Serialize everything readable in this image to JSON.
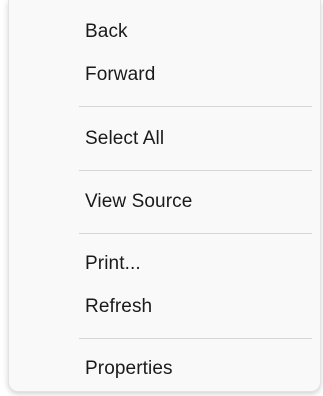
{
  "context_menu": {
    "items": [
      {
        "label": "Back"
      },
      {
        "label": "Forward"
      },
      {
        "label": "Select All"
      },
      {
        "label": "View Source"
      },
      {
        "label": "Print..."
      },
      {
        "label": "Refresh"
      },
      {
        "label": "Properties"
      }
    ]
  },
  "colors": {
    "menu_background": "#f9f9f9",
    "text": "#1a1a1a",
    "separator": "#d6d6d6"
  }
}
